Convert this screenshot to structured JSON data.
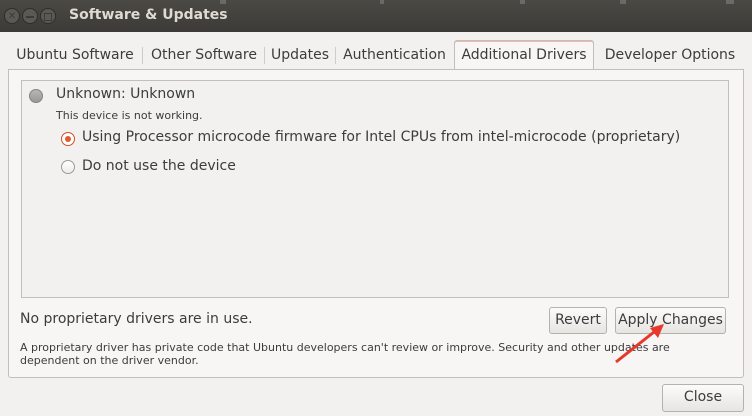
{
  "window": {
    "title": "Software & Updates"
  },
  "tabs": [
    {
      "label": "Ubuntu Software",
      "active": false
    },
    {
      "label": "Other Software",
      "active": false
    },
    {
      "label": "Updates",
      "active": false
    },
    {
      "label": "Authentication",
      "active": false
    },
    {
      "label": "Additional Drivers",
      "active": true
    },
    {
      "label": "Developer Options",
      "active": false
    }
  ],
  "drivers": {
    "device": {
      "name": "Unknown: Unknown",
      "status": "This device is not working."
    },
    "options": [
      {
        "label": "Using Processor microcode firmware for Intel CPUs from intel-microcode (proprietary)",
        "selected": true
      },
      {
        "label": "Do not use the device",
        "selected": false
      }
    ]
  },
  "footer": {
    "status": "No proprietary drivers are in use.",
    "revert_label": "Revert",
    "apply_label": "Apply Changes",
    "note": "A proprietary driver has private code that Ubuntu developers can't review or improve. Security and other updates are dependent on the driver vendor."
  },
  "dialog": {
    "close_label": "Close"
  },
  "colors": {
    "accent": "#e05b2d",
    "titlebar": "#3c3b37",
    "annotation_arrow": "#e8372c"
  }
}
